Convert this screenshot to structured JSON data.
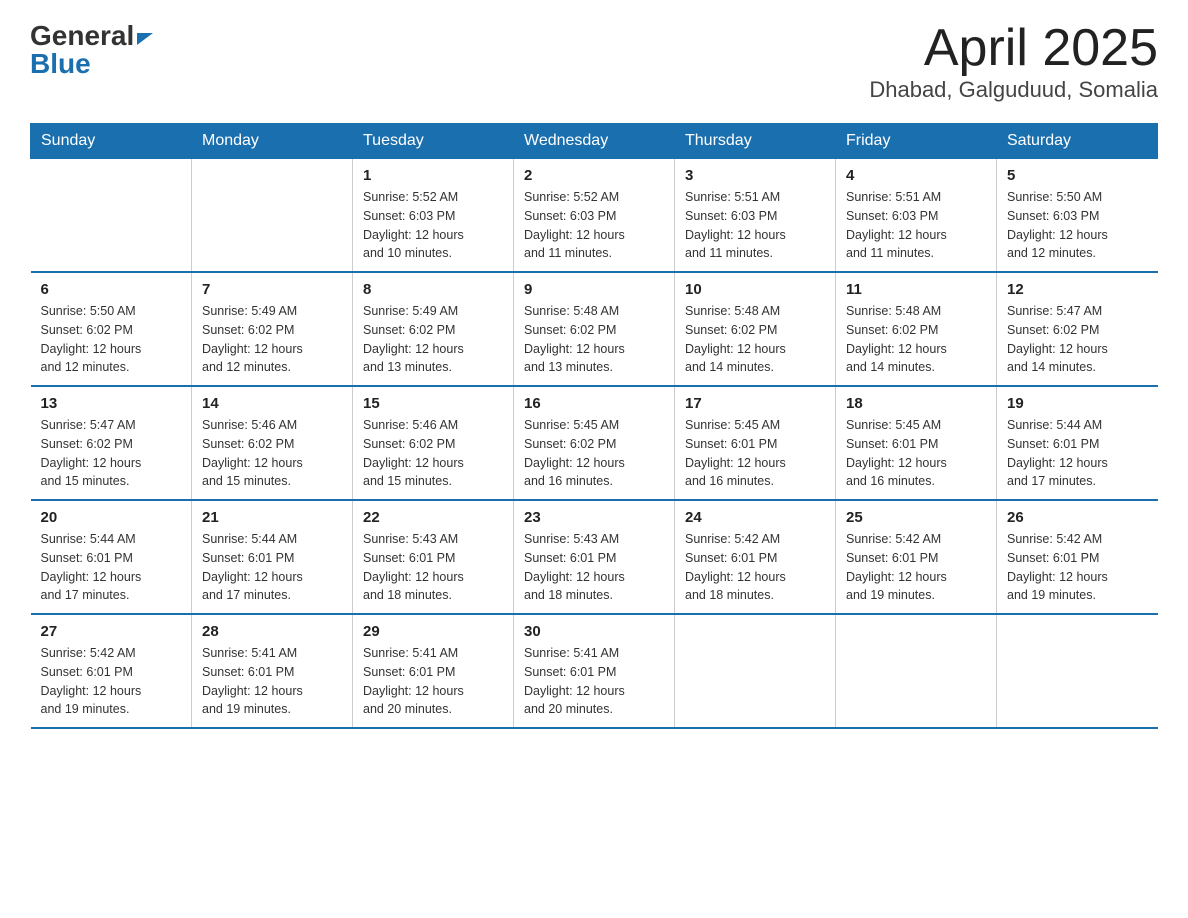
{
  "header": {
    "logo_general": "General",
    "logo_blue": "Blue",
    "month": "April 2025",
    "location": "Dhabad, Galguduud, Somalia"
  },
  "days_of_week": [
    "Sunday",
    "Monday",
    "Tuesday",
    "Wednesday",
    "Thursday",
    "Friday",
    "Saturday"
  ],
  "weeks": [
    [
      {
        "day": "",
        "info": ""
      },
      {
        "day": "",
        "info": ""
      },
      {
        "day": "1",
        "info": "Sunrise: 5:52 AM\nSunset: 6:03 PM\nDaylight: 12 hours\nand 10 minutes."
      },
      {
        "day": "2",
        "info": "Sunrise: 5:52 AM\nSunset: 6:03 PM\nDaylight: 12 hours\nand 11 minutes."
      },
      {
        "day": "3",
        "info": "Sunrise: 5:51 AM\nSunset: 6:03 PM\nDaylight: 12 hours\nand 11 minutes."
      },
      {
        "day": "4",
        "info": "Sunrise: 5:51 AM\nSunset: 6:03 PM\nDaylight: 12 hours\nand 11 minutes."
      },
      {
        "day": "5",
        "info": "Sunrise: 5:50 AM\nSunset: 6:03 PM\nDaylight: 12 hours\nand 12 minutes."
      }
    ],
    [
      {
        "day": "6",
        "info": "Sunrise: 5:50 AM\nSunset: 6:02 PM\nDaylight: 12 hours\nand 12 minutes."
      },
      {
        "day": "7",
        "info": "Sunrise: 5:49 AM\nSunset: 6:02 PM\nDaylight: 12 hours\nand 12 minutes."
      },
      {
        "day": "8",
        "info": "Sunrise: 5:49 AM\nSunset: 6:02 PM\nDaylight: 12 hours\nand 13 minutes."
      },
      {
        "day": "9",
        "info": "Sunrise: 5:48 AM\nSunset: 6:02 PM\nDaylight: 12 hours\nand 13 minutes."
      },
      {
        "day": "10",
        "info": "Sunrise: 5:48 AM\nSunset: 6:02 PM\nDaylight: 12 hours\nand 14 minutes."
      },
      {
        "day": "11",
        "info": "Sunrise: 5:48 AM\nSunset: 6:02 PM\nDaylight: 12 hours\nand 14 minutes."
      },
      {
        "day": "12",
        "info": "Sunrise: 5:47 AM\nSunset: 6:02 PM\nDaylight: 12 hours\nand 14 minutes."
      }
    ],
    [
      {
        "day": "13",
        "info": "Sunrise: 5:47 AM\nSunset: 6:02 PM\nDaylight: 12 hours\nand 15 minutes."
      },
      {
        "day": "14",
        "info": "Sunrise: 5:46 AM\nSunset: 6:02 PM\nDaylight: 12 hours\nand 15 minutes."
      },
      {
        "day": "15",
        "info": "Sunrise: 5:46 AM\nSunset: 6:02 PM\nDaylight: 12 hours\nand 15 minutes."
      },
      {
        "day": "16",
        "info": "Sunrise: 5:45 AM\nSunset: 6:02 PM\nDaylight: 12 hours\nand 16 minutes."
      },
      {
        "day": "17",
        "info": "Sunrise: 5:45 AM\nSunset: 6:01 PM\nDaylight: 12 hours\nand 16 minutes."
      },
      {
        "day": "18",
        "info": "Sunrise: 5:45 AM\nSunset: 6:01 PM\nDaylight: 12 hours\nand 16 minutes."
      },
      {
        "day": "19",
        "info": "Sunrise: 5:44 AM\nSunset: 6:01 PM\nDaylight: 12 hours\nand 17 minutes."
      }
    ],
    [
      {
        "day": "20",
        "info": "Sunrise: 5:44 AM\nSunset: 6:01 PM\nDaylight: 12 hours\nand 17 minutes."
      },
      {
        "day": "21",
        "info": "Sunrise: 5:44 AM\nSunset: 6:01 PM\nDaylight: 12 hours\nand 17 minutes."
      },
      {
        "day": "22",
        "info": "Sunrise: 5:43 AM\nSunset: 6:01 PM\nDaylight: 12 hours\nand 18 minutes."
      },
      {
        "day": "23",
        "info": "Sunrise: 5:43 AM\nSunset: 6:01 PM\nDaylight: 12 hours\nand 18 minutes."
      },
      {
        "day": "24",
        "info": "Sunrise: 5:42 AM\nSunset: 6:01 PM\nDaylight: 12 hours\nand 18 minutes."
      },
      {
        "day": "25",
        "info": "Sunrise: 5:42 AM\nSunset: 6:01 PM\nDaylight: 12 hours\nand 19 minutes."
      },
      {
        "day": "26",
        "info": "Sunrise: 5:42 AM\nSunset: 6:01 PM\nDaylight: 12 hours\nand 19 minutes."
      }
    ],
    [
      {
        "day": "27",
        "info": "Sunrise: 5:42 AM\nSunset: 6:01 PM\nDaylight: 12 hours\nand 19 minutes."
      },
      {
        "day": "28",
        "info": "Sunrise: 5:41 AM\nSunset: 6:01 PM\nDaylight: 12 hours\nand 19 minutes."
      },
      {
        "day": "29",
        "info": "Sunrise: 5:41 AM\nSunset: 6:01 PM\nDaylight: 12 hours\nand 20 minutes."
      },
      {
        "day": "30",
        "info": "Sunrise: 5:41 AM\nSunset: 6:01 PM\nDaylight: 12 hours\nand 20 minutes."
      },
      {
        "day": "",
        "info": ""
      },
      {
        "day": "",
        "info": ""
      },
      {
        "day": "",
        "info": ""
      }
    ]
  ]
}
